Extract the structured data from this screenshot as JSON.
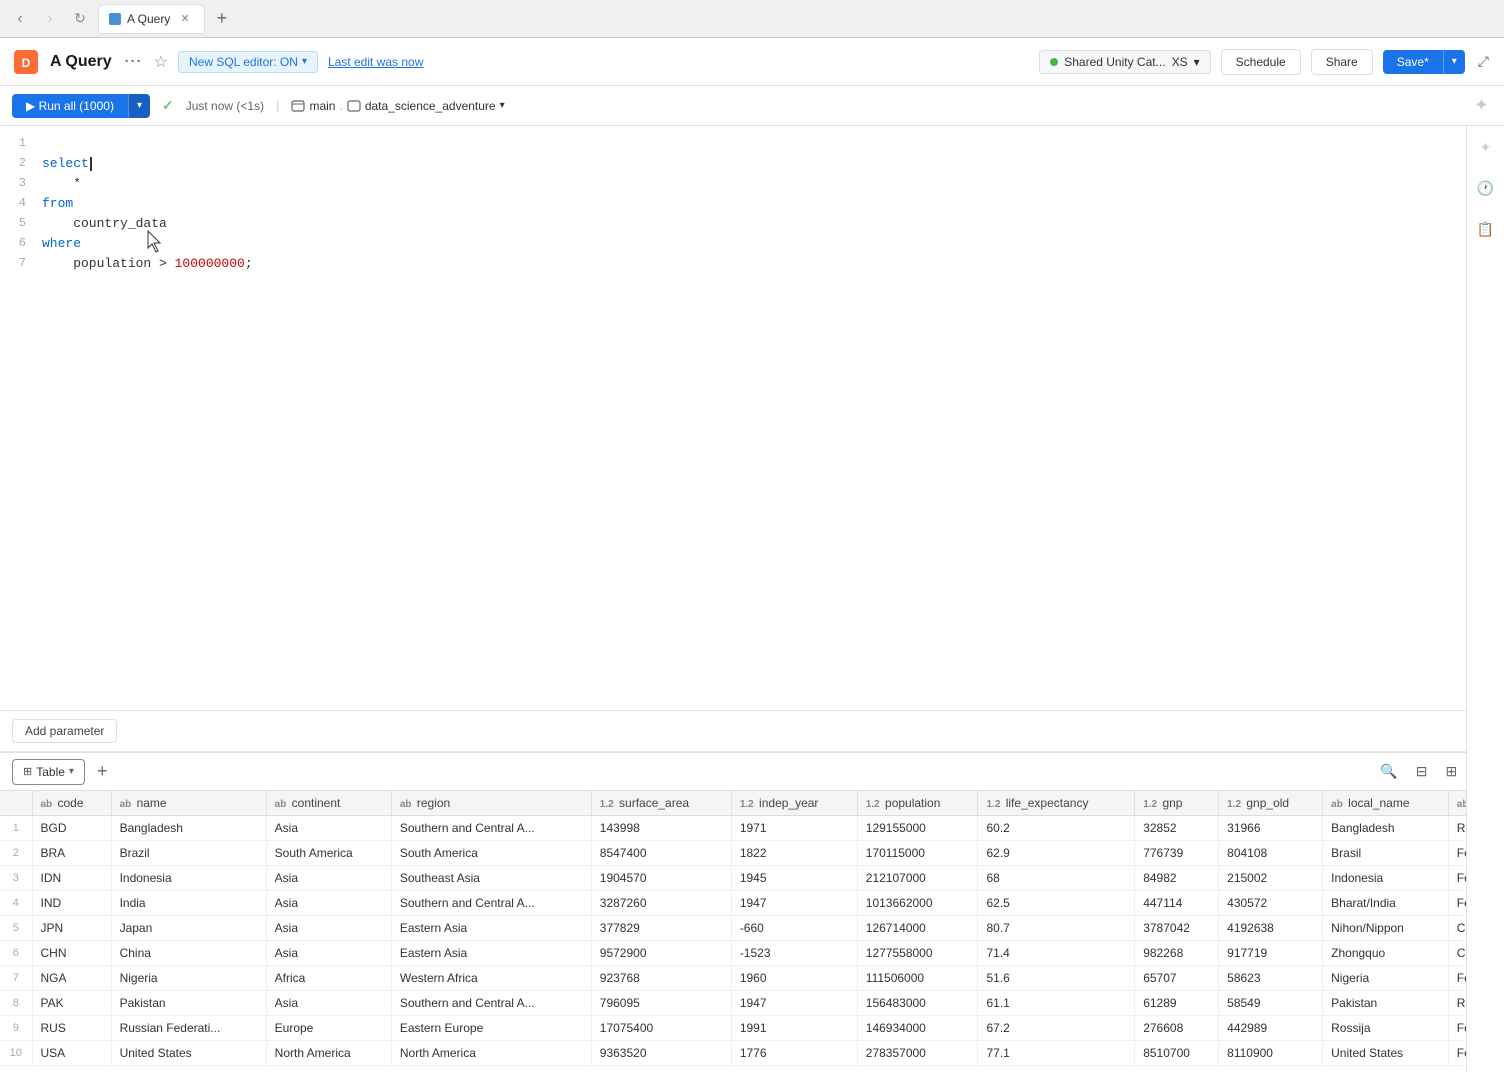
{
  "browser": {
    "tab_label": "A Query",
    "new_tab_label": "+"
  },
  "header": {
    "title": "A Query",
    "more_label": "⋯",
    "star_label": "☆",
    "editor_badge": "New SQL editor: ON",
    "last_edit": "Last edit was now",
    "catalog_label": "Shared Unity Cat...",
    "catalog_size": "XS",
    "schedule_label": "Schedule",
    "share_label": "Share",
    "save_label": "Save*"
  },
  "toolbar": {
    "run_label": "▶ Run all (1000)",
    "check_label": "✓",
    "time_label": "Just now (<1s)",
    "db_main": "main",
    "db_schema": "data_science_adventure",
    "pin_label": "⊕"
  },
  "editor": {
    "lines": [
      {
        "num": 1,
        "code": ""
      },
      {
        "num": 2,
        "code": "select",
        "highlight": "kw",
        "cursor": true
      },
      {
        "num": 3,
        "code": "    *"
      },
      {
        "num": 4,
        "code": "from",
        "highlight": "kw"
      },
      {
        "num": 5,
        "code": "    country_data"
      },
      {
        "num": 6,
        "code": "where",
        "highlight": "kw"
      },
      {
        "num": 7,
        "code": "    population > 100000000;"
      }
    ]
  },
  "add_param": {
    "label": "Add parameter"
  },
  "results": {
    "tab_label": "Table",
    "tab_arrow": "▾"
  },
  "table": {
    "columns": [
      {
        "id": "row_num",
        "label": "",
        "type": ""
      },
      {
        "id": "code",
        "label": "code",
        "type": "ab"
      },
      {
        "id": "name",
        "label": "name",
        "type": "ab"
      },
      {
        "id": "continent",
        "label": "continent",
        "type": "ab"
      },
      {
        "id": "region",
        "label": "region",
        "type": "ab"
      },
      {
        "id": "surface_area",
        "label": "surface_area",
        "type": "12"
      },
      {
        "id": "indep_year",
        "label": "indep_year",
        "type": "12"
      },
      {
        "id": "population",
        "label": "population",
        "type": "12"
      },
      {
        "id": "life_expectancy",
        "label": "life_expectancy",
        "type": "12"
      },
      {
        "id": "gnp",
        "label": "gnp",
        "type": "12"
      },
      {
        "id": "gnp_old",
        "label": "gnp_old",
        "type": "12"
      },
      {
        "id": "local_name",
        "label": "local_name",
        "type": "ab"
      },
      {
        "id": "extra",
        "label": "",
        "type": "ab"
      }
    ],
    "rows": [
      {
        "row_num": 1,
        "code": "BGD",
        "name": "Bangladesh",
        "continent": "Asia",
        "region": "Southern and Central A...",
        "surface_area": "143998",
        "indep_year": "1971",
        "population": "129155000",
        "life_expectancy": "60.2",
        "gnp": "32852",
        "gnp_old": "31966",
        "local_name": "Bangladesh",
        "extra": "Rep"
      },
      {
        "row_num": 2,
        "code": "BRA",
        "name": "Brazil",
        "continent": "South America",
        "region": "South America",
        "surface_area": "8547400",
        "indep_year": "1822",
        "population": "170115000",
        "life_expectancy": "62.9",
        "gnp": "776739",
        "gnp_old": "804108",
        "local_name": "Brasil",
        "extra": "Fed"
      },
      {
        "row_num": 3,
        "code": "IDN",
        "name": "Indonesia",
        "continent": "Asia",
        "region": "Southeast Asia",
        "surface_area": "1904570",
        "indep_year": "1945",
        "population": "212107000",
        "life_expectancy": "68",
        "gnp": "84982",
        "gnp_old": "215002",
        "local_name": "Indonesia",
        "extra": "Fed"
      },
      {
        "row_num": 4,
        "code": "IND",
        "name": "India",
        "continent": "Asia",
        "region": "Southern and Central A...",
        "surface_area": "3287260",
        "indep_year": "1947",
        "population": "1013662000",
        "life_expectancy": "62.5",
        "gnp": "447114",
        "gnp_old": "430572",
        "local_name": "Bharat/India",
        "extra": "Fed"
      },
      {
        "row_num": 5,
        "code": "JPN",
        "name": "Japan",
        "continent": "Asia",
        "region": "Eastern Asia",
        "surface_area": "377829",
        "indep_year": "-660",
        "population": "126714000",
        "life_expectancy": "80.7",
        "gnp": "3787042",
        "gnp_old": "4192638",
        "local_name": "Nihon/Nippon",
        "extra": "Con"
      },
      {
        "row_num": 6,
        "code": "CHN",
        "name": "China",
        "continent": "Asia",
        "region": "Eastern Asia",
        "surface_area": "9572900",
        "indep_year": "-1523",
        "population": "1277558000",
        "life_expectancy": "71.4",
        "gnp": "982268",
        "gnp_old": "917719",
        "local_name": "Zhongquo",
        "extra": "Com"
      },
      {
        "row_num": 7,
        "code": "NGA",
        "name": "Nigeria",
        "continent": "Africa",
        "region": "Western Africa",
        "surface_area": "923768",
        "indep_year": "1960",
        "population": "111506000",
        "life_expectancy": "51.6",
        "gnp": "65707",
        "gnp_old": "58623",
        "local_name": "Nigeria",
        "extra": "Fed"
      },
      {
        "row_num": 8,
        "code": "PAK",
        "name": "Pakistan",
        "continent": "Asia",
        "region": "Southern and Central A...",
        "surface_area": "796095",
        "indep_year": "1947",
        "population": "156483000",
        "life_expectancy": "61.1",
        "gnp": "61289",
        "gnp_old": "58549",
        "local_name": "Pakistan",
        "extra": "Rep"
      },
      {
        "row_num": 9,
        "code": "RUS",
        "name": "Russian Federati...",
        "continent": "Europe",
        "region": "Eastern Europe",
        "surface_area": "17075400",
        "indep_year": "1991",
        "population": "146934000",
        "life_expectancy": "67.2",
        "gnp": "276608",
        "gnp_old": "442989",
        "local_name": "Rossija",
        "extra": "Fed"
      },
      {
        "row_num": 10,
        "code": "USA",
        "name": "United States",
        "continent": "North America",
        "region": "North America",
        "surface_area": "9363520",
        "indep_year": "1776",
        "population": "278357000",
        "life_expectancy": "77.1",
        "gnp": "8510700",
        "gnp_old": "8110900",
        "local_name": "United States",
        "extra": "Fed"
      }
    ]
  },
  "icons": {
    "search": "🔍",
    "filter": "⊟",
    "grid": "⊞",
    "close": "✕",
    "clock": "🕐",
    "info": "ℹ",
    "expand": "⤢",
    "sparkle": "✦",
    "comment": "💬",
    "chevron_down": "▾",
    "chevron_up": "▲",
    "pin": "📌",
    "calendar": "📅",
    "share": "↗",
    "table_icon": "⊞",
    "ab_icon": "ab",
    "num_icon": "1.2"
  }
}
